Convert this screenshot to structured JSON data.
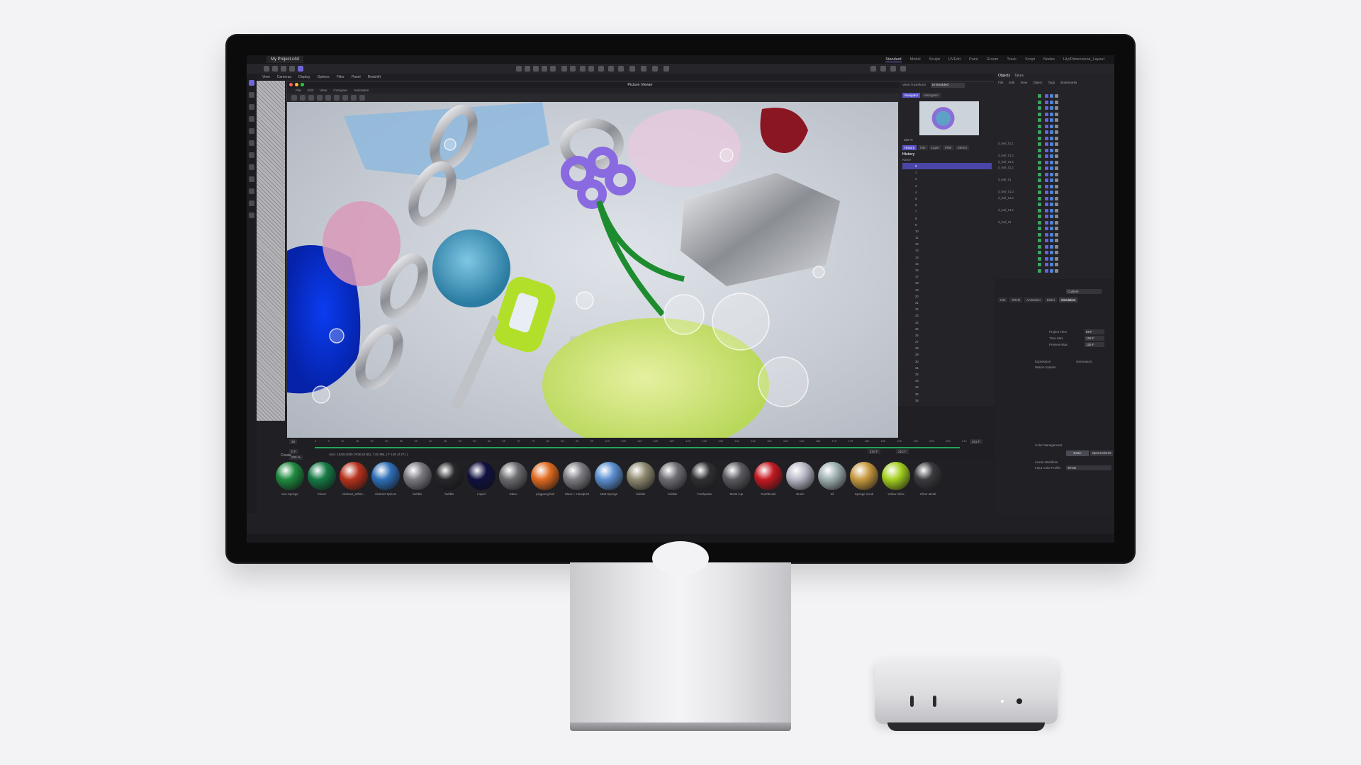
{
  "app": {
    "doc_tab": "My Project.c4d",
    "layouts": [
      "Standard",
      "Model",
      "Sculpt",
      "UVEdit",
      "Paint",
      "Groom",
      "Track",
      "Script",
      "Nodes",
      "Lily/Dimensions_Layout"
    ],
    "active_layout": "Standard",
    "menu": [
      "View",
      "Cameras",
      "Display",
      "Options",
      "Filter",
      "Panel",
      "Redshift"
    ]
  },
  "picture_viewer": {
    "title": "Picture Viewer",
    "menu": [
      "File",
      "Edit",
      "View",
      "Compare",
      "Animation"
    ],
    "view_transform_label": "View Transform",
    "view_transform_value": "Embedded",
    "nav_tabs": [
      "Navigator",
      "Histogram"
    ],
    "zoom": "200 %",
    "hist_tabs": [
      "History",
      "Info",
      "Layer",
      "Filter",
      "Stereo"
    ],
    "history_title": "History",
    "history_col": "Name",
    "history_rows": [
      "0",
      "1",
      "2",
      "3",
      "4",
      "5",
      "6",
      "7",
      "8",
      "9",
      "10",
      "11",
      "12",
      "13",
      "14",
      "15",
      "16",
      "17",
      "18",
      "19",
      "20",
      "21",
      "22",
      "23",
      "24",
      "25",
      "26",
      "27",
      "28",
      "29",
      "30",
      "31",
      "32",
      "33",
      "34",
      "35",
      "36"
    ],
    "size_info": "Size: 1920x1080, RGB (8 Bit), 7,92 MB, ( F 100 of 271 )",
    "left_zoom": "200 %"
  },
  "timeline": {
    "ticks": [
      "0",
      "5",
      "10",
      "15",
      "20",
      "25",
      "30",
      "35",
      "40",
      "45",
      "50",
      "55",
      "60",
      "65",
      "70",
      "75",
      "80",
      "85",
      "90",
      "95",
      "100",
      "105",
      "110",
      "115",
      "120",
      "125",
      "130",
      "135",
      "140",
      "145",
      "150",
      "155",
      "160",
      "165",
      "170",
      "175",
      "180",
      "185",
      "190",
      "195",
      "200",
      "205",
      "210"
    ],
    "start_frame": "0 F",
    "current": "210 F",
    "end": "210 F",
    "total": "261 F",
    "left_value": "30"
  },
  "materials": [
    {
      "name": "Sea Sponge",
      "color": "#1f8a3f"
    },
    {
      "name": "Clover",
      "color": "#157a45"
    },
    {
      "name": "Abstract_White...",
      "color": "#b8321c"
    },
    {
      "name": "Abstract Sphere",
      "color": "#2e6fb8"
    },
    {
      "name": "bubble",
      "color": "#7a7a82"
    },
    {
      "name": "bubble",
      "color": "#26262b"
    },
    {
      "name": "Liquid",
      "color": "#101040"
    },
    {
      "name": "Glass",
      "color": "#6b6b70"
    },
    {
      "name": "pingpong ball",
      "color": "#e06a20"
    },
    {
      "name": "Glass + Handprint",
      "color": "#7c7c82"
    },
    {
      "name": "Matt Sponge",
      "color": "#5b8fd0"
    },
    {
      "name": "bubble",
      "color": "#8f8a70"
    },
    {
      "name": "bubble",
      "color": "#6d6d74"
    },
    {
      "name": "Toothpaste",
      "color": "#303034"
    },
    {
      "name": "Metal cup",
      "color": "#5a5a60"
    },
    {
      "name": "Toothbrush",
      "color": "#c41a22"
    },
    {
      "name": "Brush",
      "color": "#b8b8c8"
    },
    {
      "name": "Sil",
      "color": "#9fb0b2"
    },
    {
      "name": "Sponge scrub",
      "color": "#c89a40"
    },
    {
      "name": "Yellow shine",
      "color": "#a4d020"
    },
    {
      "name": "Silver Metal",
      "color": "#3a3a3f"
    }
  ],
  "materials_header": "Create",
  "objects": {
    "tabs": [
      "Objects",
      "Takes"
    ],
    "menu": [
      "File",
      "Edit",
      "View",
      "Object",
      "Tags",
      "Bookmarks"
    ],
    "rows": [
      "",
      "",
      "",
      "",
      "",
      "",
      "",
      "",
      "d_leaf_01.1",
      "",
      "d_leaf_01.2",
      "d_leaf_01.2",
      "d_leaf_01.2",
      "",
      "d_leaf_01",
      "",
      "d_leaf_01.3",
      "d_leaf_01.2",
      "",
      "d_leaf_01.2",
      "",
      "d_leaf_01",
      "",
      "",
      "",
      "",
      "",
      "",
      "",
      ""
    ]
  },
  "attributes": {
    "mode_value": "Custom",
    "tabs": [
      "Info",
      "XRefs",
      "Animation",
      "Bullet",
      "Simulation"
    ],
    "fields": [
      {
        "label": "Project Time",
        "value": "59 F"
      },
      {
        "label": "Time Max",
        "value": "126 F"
      },
      {
        "label": "Preview Max",
        "value": "126 F"
      }
    ],
    "checks": [
      "Generators",
      "Expression",
      "Motion System"
    ],
    "color_tabs": [
      "Basic",
      "OpenColorIO"
    ],
    "linear_label": "Linear Workflow",
    "input_profile_label": "Input Color Profile",
    "input_profile_value": "sRGB",
    "color_mgmt_label": "Color Management"
  }
}
